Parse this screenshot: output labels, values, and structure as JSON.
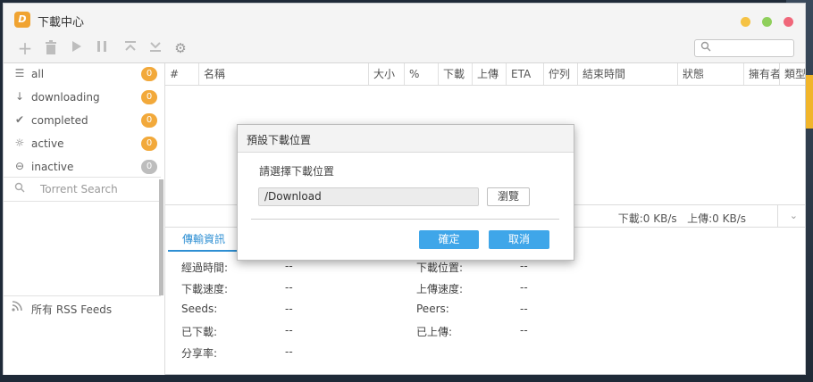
{
  "app": {
    "logo_text": "D",
    "title": "下載中心"
  },
  "window_controls": {
    "colors": [
      "#f5c244",
      "#8fcf5b",
      "#f0677a"
    ]
  },
  "toolbar": {
    "icons": [
      "plus-icon",
      "trash-icon",
      "play-icon",
      "pause-icon",
      "move-top-icon",
      "move-bottom-icon",
      "gear-icon"
    ],
    "search_placeholder": ""
  },
  "sidebar": {
    "items": [
      {
        "label": "all",
        "count": "0",
        "icon": "list-icon"
      },
      {
        "label": "downloading",
        "count": "0",
        "icon": "arrow-down-icon"
      },
      {
        "label": "completed",
        "count": "0",
        "icon": "check-icon"
      },
      {
        "label": "active",
        "count": "0",
        "icon": "gear-sun-icon"
      },
      {
        "label": "inactive",
        "count": "0",
        "icon": "minus-circle-icon"
      }
    ],
    "torrent_search": "Torrent Search",
    "rss": "所有 RSS Feeds"
  },
  "table": {
    "columns": [
      "#",
      "名稱",
      "大小",
      "%",
      "下載",
      "上傳",
      "ETA",
      "佇列",
      "結束時間",
      "狀態",
      "擁有者",
      "類型"
    ]
  },
  "status": {
    "download": "下載:0 KB/s",
    "upload": "上傳:0 KB/s"
  },
  "details": {
    "tab": "傳輸資訊",
    "left": [
      {
        "label": "經過時間:",
        "value": "--"
      },
      {
        "label": "下載速度:",
        "value": "--"
      },
      {
        "label": "Seeds:",
        "value": "--"
      },
      {
        "label": "已下載:",
        "value": "--"
      },
      {
        "label": "分享率:",
        "value": "--"
      }
    ],
    "right": [
      {
        "label": "下載位置:",
        "value": "--"
      },
      {
        "label": "上傳速度:",
        "value": "--"
      },
      {
        "label": "Peers:",
        "value": "--"
      },
      {
        "label": "已上傳:",
        "value": "--"
      }
    ]
  },
  "dialog": {
    "title": "預設下載位置",
    "prompt": "請選擇下載位置",
    "path": "/Download",
    "browse": "瀏覽",
    "ok": "確定",
    "cancel": "取消"
  },
  "colors": {
    "accent": "#3fa6e9",
    "badge": "#f2a93b",
    "badge_inactive": "#bdbdbd"
  }
}
